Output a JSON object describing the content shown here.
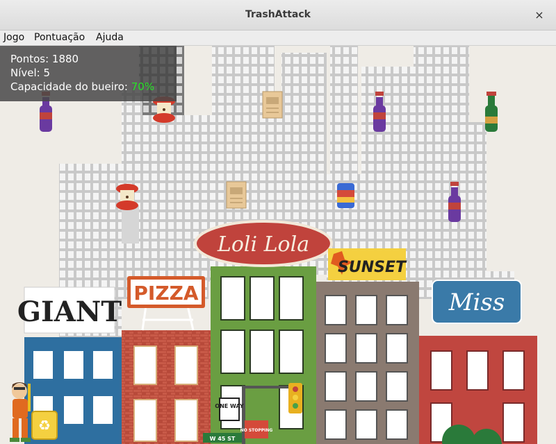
{
  "window": {
    "title": "TrashAttack",
    "close_glyph": "×"
  },
  "menu": {
    "items": [
      "Jogo",
      "Pontuação",
      "Ajuda"
    ]
  },
  "hud": {
    "score_label": "Pontos:",
    "score": "1880",
    "level_label": "Nível:",
    "level": "5",
    "capacity_label": "Capacidade do bueiro:",
    "capacity": "70%",
    "capacity_color": "#27e227"
  },
  "signs": {
    "giant": "GIANT",
    "pizza": "PIZZA",
    "loli_lola": "Loli Lola",
    "sunset": "SUNSET",
    "miss": "Miss",
    "one_way": "ONE WAY",
    "no_stopping": "NO STOPPING",
    "street": "W 45 ST"
  },
  "trash_items": [
    "soda-bottle",
    "apple-core",
    "newspaper",
    "soda-bottle",
    "green-bottle",
    "apple-core",
    "newspaper",
    "juice-can",
    "soda-bottle"
  ],
  "colors": {
    "building_blue": "#2e6fa0",
    "building_brick": "#b84a3a",
    "building_green": "#6a9e42",
    "building_brown": "#8a7a70",
    "building_red": "#c0463f",
    "lola_sign": "#c0433c"
  }
}
